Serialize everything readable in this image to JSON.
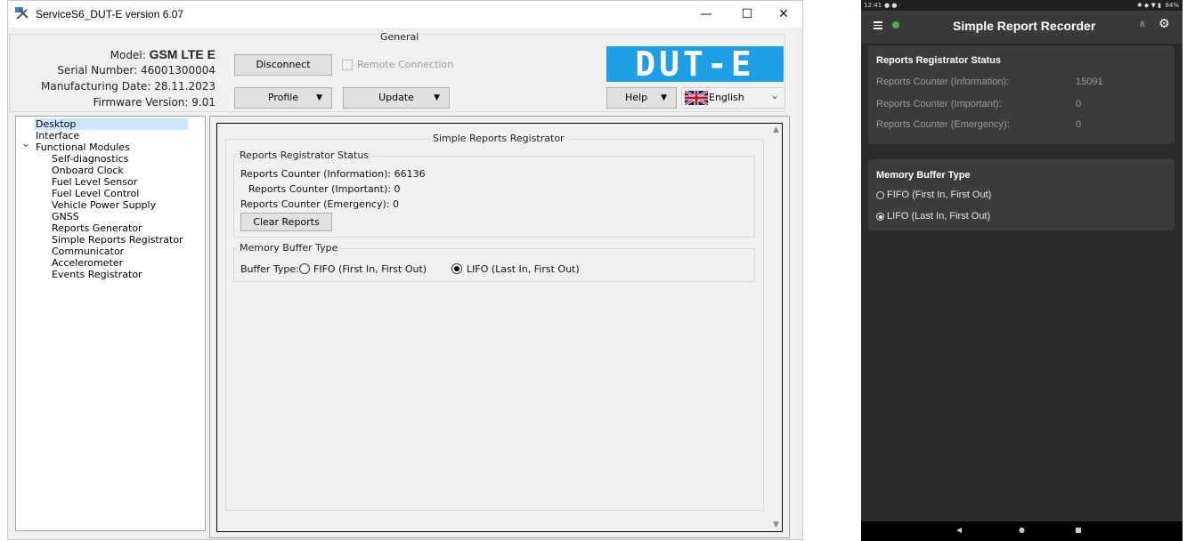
{
  "desktop": {
    "window_title": "ServiceS6_DUT-E version 6.07",
    "window_controls": {
      "minimize": "—",
      "maximize": "☐",
      "close": "✕"
    },
    "general_legend": "General",
    "device": {
      "model_label": "Model:",
      "model_value": "GSM LTE E",
      "serial_label": "Serial Number:",
      "serial_value": "46001300004",
      "mfg_label": "Manufacturing Date:",
      "mfg_value": "28.11.2023",
      "fw_label": "Firmware Version:",
      "fw_value": "9.01"
    },
    "buttons": {
      "disconnect": "Disconnect",
      "remote_connection": "Remote Connection",
      "profile": "Profile",
      "update": "Update",
      "help": "Help",
      "language": "English",
      "dropdown_arrow": "▼",
      "chevron": "⌄"
    },
    "logo_text": "DUT-E",
    "tree": {
      "items": [
        "Desktop",
        "Interface",
        "Functional Modules",
        "Self-diagnostics",
        "Onboard Clock",
        "Fuel Level Sensor",
        "Fuel Level Control",
        "Vehicle Power Supply",
        "GNSS",
        "Reports Generator",
        "Simple Reports Registrator",
        "Communicator",
        "Accelerometer",
        "Events Registrator"
      ],
      "selected": "Simple Reports Registrator",
      "expander": "⌄"
    },
    "panel": {
      "title": "Simple Reports Registrator",
      "status_legend": "Reports Registrator Status",
      "info_label": "Reports Counter (Information):",
      "info_value": "66136",
      "important_label": "Reports Counter (Important):",
      "important_value": "0",
      "emergency_label": "Reports Counter (Emergency):",
      "emergency_value": "0",
      "clear_button": "Clear Reports",
      "buffer_legend": "Memory Buffer Type",
      "buffer_type_label": "Buffer Type:",
      "fifo_label": "FIFO (First In, First Out)",
      "lifo_label": "LIFO (Last In, First Out)",
      "selected_buffer": "LIFO"
    }
  },
  "mobile": {
    "status_time": "12:41",
    "status_right": "84%",
    "app_title": "Simple Report Recorder",
    "status_card": {
      "title": "Reports Registrator Status",
      "info_label": "Reports Counter (Information):",
      "info_value": "15091",
      "important_label": "Reports Counter (Important):",
      "important_value": "0",
      "emergency_label": "Reports Counter (Emergency):",
      "emergency_value": "0"
    },
    "buffer_card": {
      "title": "Memory Buffer Type",
      "fifo_label": "FIFO (First In, First Out)",
      "lifo_label": "LIFO (Last In, First Out)",
      "selected": "LIFO"
    },
    "nav": {
      "back": "◀",
      "home": "●",
      "recents": "■"
    },
    "colors": {
      "connected_dot": "#4caf50",
      "app_bg": "#2b2b2b",
      "card_bg": "#3c3c3c"
    }
  }
}
